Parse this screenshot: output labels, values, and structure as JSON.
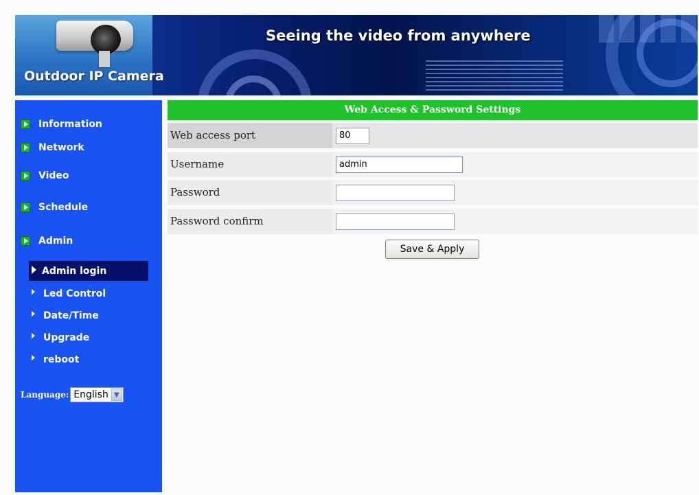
{
  "banner": {
    "brand": "Outdoor IP Camera",
    "tagline": "Seeing the video from anywhere"
  },
  "sidebar": {
    "items": [
      {
        "label": "Information",
        "icon": "green-arrow-icon"
      },
      {
        "label": "Network",
        "icon": "green-arrow-icon"
      },
      {
        "label": "Video",
        "icon": "green-arrow-icon"
      },
      {
        "label": "Schedule",
        "icon": "green-arrow-icon"
      },
      {
        "label": "Admin",
        "icon": "green-arrow-icon"
      }
    ],
    "subitems": [
      {
        "label": "Admin login",
        "active": true
      },
      {
        "label": "Led Control",
        "active": false
      },
      {
        "label": "Date/Time",
        "active": false
      },
      {
        "label": "Upgrade",
        "active": false
      },
      {
        "label": "reboot",
        "active": false
      }
    ],
    "language": {
      "label": "Language:",
      "selected": "English"
    }
  },
  "main": {
    "title": "Web Access & Password Settings",
    "fields": [
      {
        "label": "Web access port",
        "value": ""
      },
      {
        "label": "Username",
        "value": "admin"
      },
      {
        "label": "Password",
        "value": ""
      },
      {
        "label": "Password confirm",
        "value": ""
      }
    ],
    "port_value": "80",
    "save_label": "Save & Apply"
  },
  "colors": {
    "sidebar": "#1a53f4",
    "header": "#1fc22b",
    "active_item": "#07116b"
  }
}
